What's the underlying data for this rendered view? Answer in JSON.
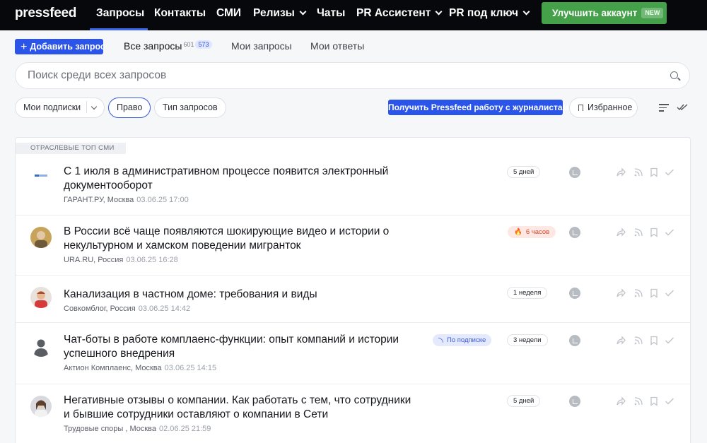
{
  "header": {
    "logo": "pressfeed",
    "nav": [
      {
        "label": "Запросы",
        "dropdown": false
      },
      {
        "label": "Контакты",
        "dropdown": false
      },
      {
        "label": "СМИ",
        "dropdown": false
      },
      {
        "label": "Релизы",
        "dropdown": true
      },
      {
        "label": "Чаты",
        "dropdown": false
      },
      {
        "label": "PR Ассистент",
        "dropdown": true
      },
      {
        "label": "PR под ключ",
        "dropdown": true
      }
    ],
    "upgrade_label": "Улучшить аккаунт",
    "upgrade_badge": "NEW"
  },
  "toolbar": {
    "add_label": "Добавить запрос",
    "tabs": [
      {
        "label": "Все запросы",
        "count": "601",
        "badge": "573"
      },
      {
        "label": "Мои запросы"
      },
      {
        "label": "Мои ответы"
      }
    ]
  },
  "search": {
    "placeholder": "Поиск среди всех запросов"
  },
  "filters": {
    "subscriptions": "Мои подписки",
    "law": "Право",
    "type": "Тип запросов",
    "promo": "Получить Pressfeed работу с журналистами",
    "favorites": "Избранное"
  },
  "list": {
    "section": "ОТРАСЛЕВЫЕ ТОП СМИ",
    "items": [
      {
        "title": "С 1 июля в административном процессе появится электронный документооборот",
        "source": "ГАРАНТ.РУ, Москва",
        "date": "03.06.25 17:00",
        "time": "5 дней",
        "hot": false,
        "subscription": ""
      },
      {
        "title": "В России всё чаще появляются шокирующие видео и истории о некультурном и хамском поведении мигранток",
        "source": "URA.RU, Россия",
        "date": "03.06.25 16:28",
        "time": "6 часов",
        "hot": true,
        "subscription": ""
      },
      {
        "title": "Канализация в частном доме: требования и виды",
        "source": "Совкомблог, Россия",
        "date": "03.06.25 14:42",
        "time": "1 неделя",
        "hot": false,
        "subscription": ""
      },
      {
        "title": "Чат-боты в работе комплаенс-функции: опыт компаний и истории успешного внедрения",
        "source": "Актион Комплаенс, Москва",
        "date": "03.06.25 14:15",
        "time": "3 недели",
        "hot": false,
        "subscription": "По подписке"
      },
      {
        "title": "Негативные отзывы о компании. Как работать с тем, что сотрудники и бывшие сотрудники оставляют о компании в Сети",
        "source": "Трудовые споры , Москва",
        "date": "02.06.25 21:59",
        "time": "5 дней",
        "hot": false,
        "subscription": ""
      }
    ]
  },
  "colors": {
    "accent": "#2b55e8",
    "upgrade": "#45a04a",
    "hot": "#d8452c"
  }
}
